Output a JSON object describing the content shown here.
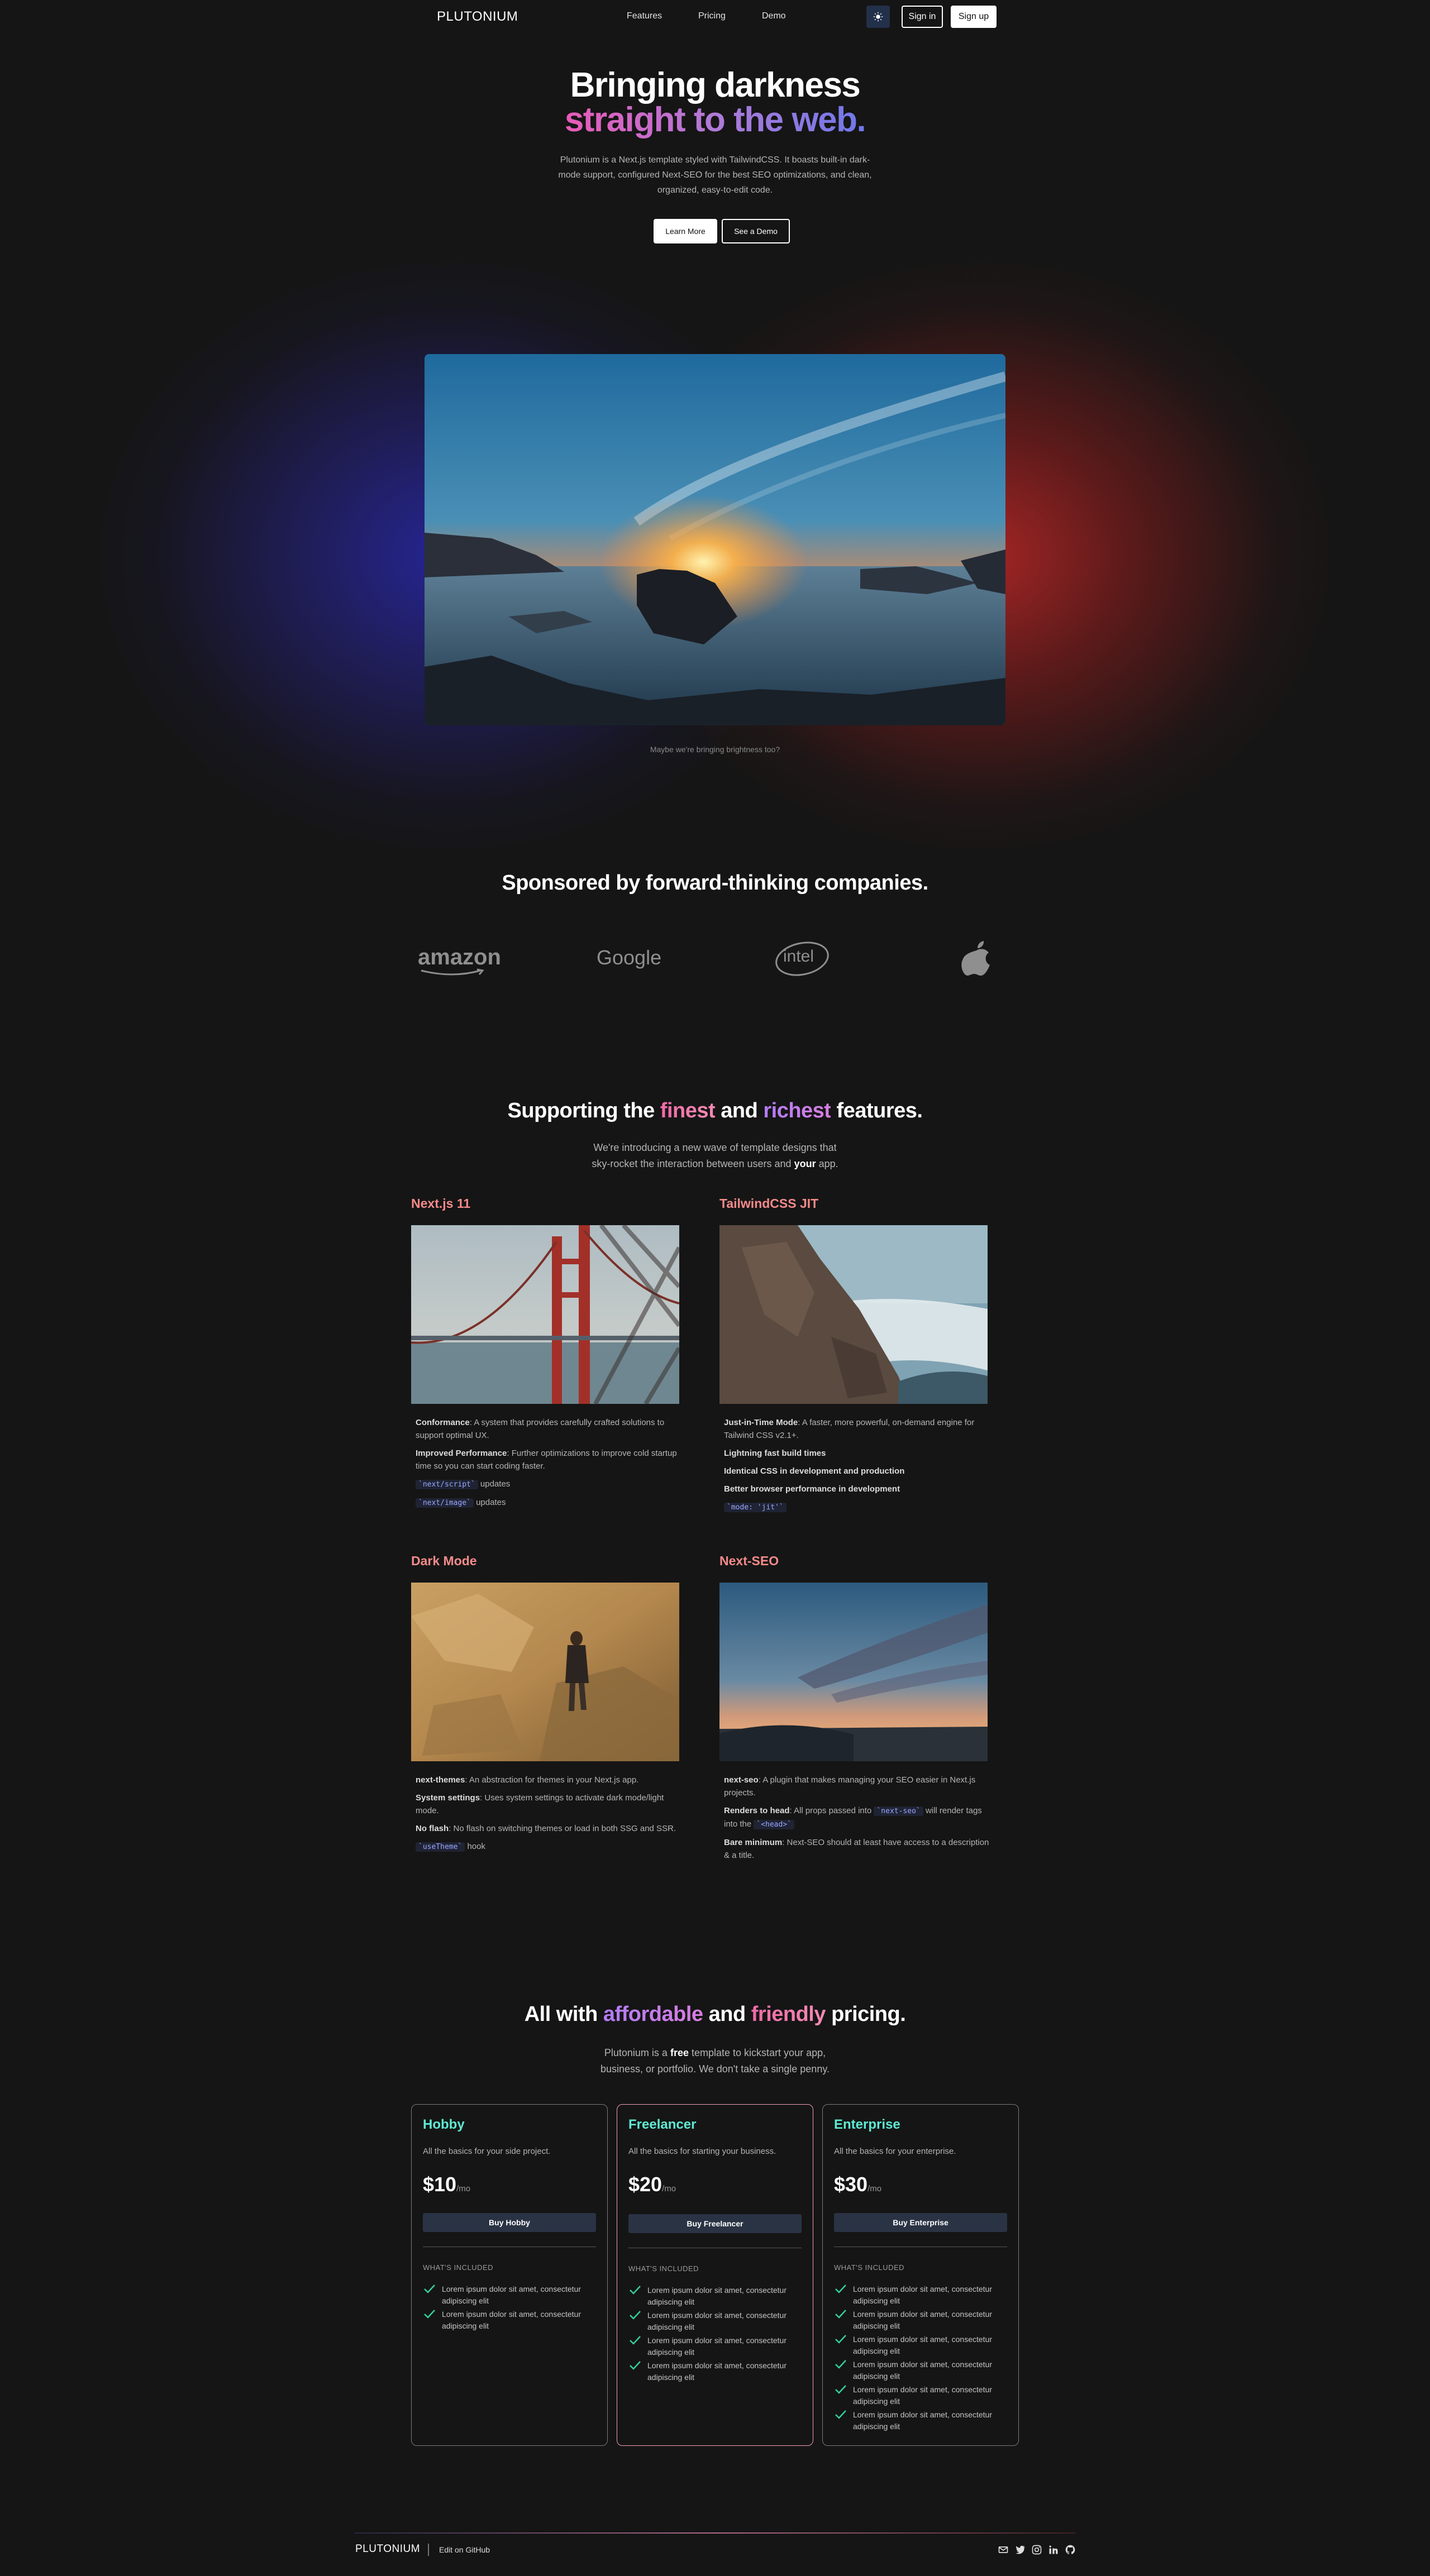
{
  "nav": {
    "brand": "PLUTONIUM",
    "links": [
      "Features",
      "Pricing",
      "Demo"
    ],
    "theme_icon": "sun-icon",
    "sign_in": "Sign in",
    "sign_up": "Sign up"
  },
  "hero": {
    "title_line1": "Bringing darkness",
    "title_line2": "straight to the web.",
    "description": "Plutonium is a Next.js template styled with TailwindCSS. It boasts built-in dark-mode support, configured Next-SEO for the best SEO optimizations, and clean, organized, easy-to-edit code.",
    "learn_more": "Learn More",
    "see_demo": "See a Demo",
    "caption": "Maybe we're bringing brightness too?"
  },
  "sponsors": {
    "title": "Sponsored by forward-thinking companies.",
    "logos": [
      "amazon",
      "Google",
      "intel",
      "apple-logo"
    ]
  },
  "features": {
    "title_pre": "Supporting the",
    "title_w1": "finest",
    "title_mid": "and",
    "title_w2": "richest",
    "title_post": "features.",
    "sub_line1": "We're introducing a new wave of template designs that",
    "sub_line2_pre": "sky-rocket the interaction between users and",
    "sub_line2_bold": "your",
    "sub_line2_post": "app.",
    "items": [
      {
        "title": "Next.js 11",
        "b1": "Conformance",
        "t1": ": A system that provides carefully crafted solutions to support optimal UX.",
        "b2": "Improved Performance",
        "t2": ": Further optimizations to improve cold startup time so you can start coding faster.",
        "code1": "`next/script`",
        "t3": " updates",
        "code2": "`next/image`",
        "t4": " updates"
      },
      {
        "title": "TailwindCSS JIT",
        "b1": "Just-in-Time Mode",
        "t1": ": A faster, more powerful, on-demand engine for Tailwind CSS v2.1+.",
        "l2": "Lightning fast build times",
        "l3": "Identical CSS in development and production",
        "l4": "Better browser performance in development",
        "code1": "`mode: 'jit'`"
      },
      {
        "title": "Dark Mode",
        "b1": "next-themes",
        "t1": ": An abstraction for themes in your Next.js app.",
        "b2": "System settings",
        "t2": ": Uses system settings to activate dark mode/light mode.",
        "b3": "No flash",
        "t3": ": No flash on switching themes or load in both SSG and SSR.",
        "code1": "`useTheme`",
        "t4": " hook"
      },
      {
        "title": "Next-SEO",
        "b1": "next-seo",
        "t1": ": A plugin that makes managing your SEO easier in Next.js projects.",
        "b2": "Renders to head",
        "t2a": ": All props passed into ",
        "code1": "`next-seo`",
        "t2b": " will render tags into the ",
        "code2": "`<head>`",
        "b3": "Bare minimum",
        "t3": ": Next-SEO should at least have access to a description & a title."
      }
    ]
  },
  "pricing": {
    "title_pre": "All with",
    "title_w1": "affordable",
    "title_mid": "and",
    "title_w2": "friendly",
    "title_post": "pricing.",
    "sub_line1_pre": "Plutonium is a",
    "sub_line1_bold": "free",
    "sub_line1_post": "template to kickstart your app,",
    "sub_line2": "business, or portfolio. We don't take a single penny.",
    "included_label": "WHAT'S INCLUDED",
    "per": "/mo",
    "plans": [
      {
        "name": "Hobby",
        "desc": "All the basics for your side project.",
        "price": "$10",
        "button": "Buy Hobby",
        "features": [
          "Lorem ipsum dolor sit amet, consectetur adipiscing elit",
          "Lorem ipsum dolor sit amet, consectetur adipiscing elit"
        ]
      },
      {
        "name": "Freelancer",
        "desc": "All the basics for starting your business.",
        "price": "$20",
        "button": "Buy Freelancer",
        "features": [
          "Lorem ipsum dolor sit amet, consectetur adipiscing elit",
          "Lorem ipsum dolor sit amet, consectetur adipiscing elit",
          "Lorem ipsum dolor sit amet, consectetur adipiscing elit",
          "Lorem ipsum dolor sit amet, consectetur adipiscing elit"
        ]
      },
      {
        "name": "Enterprise",
        "desc": "All the basics for your enterprise.",
        "price": "$30",
        "button": "Buy Enterprise",
        "features": [
          "Lorem ipsum dolor sit amet, consectetur adipiscing elit",
          "Lorem ipsum dolor sit amet, consectetur adipiscing elit",
          "Lorem ipsum dolor sit amet, consectetur adipiscing elit",
          "Lorem ipsum dolor sit amet, consectetur adipiscing elit",
          "Lorem ipsum dolor sit amet, consectetur adipiscing elit",
          "Lorem ipsum dolor sit amet, consectetur adipiscing elit"
        ]
      }
    ]
  },
  "footer": {
    "brand": "PLUTONIUM",
    "github": "Edit on GitHub",
    "icons": [
      "mail-icon",
      "twitter-icon",
      "instagram-icon",
      "linkedin-icon",
      "github-icon"
    ]
  },
  "colors": {
    "background": "#151515",
    "feature_title": "#f58a8a",
    "plan_name": "#5eead4",
    "pink": "#f472b6",
    "purple": "#b17cf7",
    "check": "#34d399"
  }
}
